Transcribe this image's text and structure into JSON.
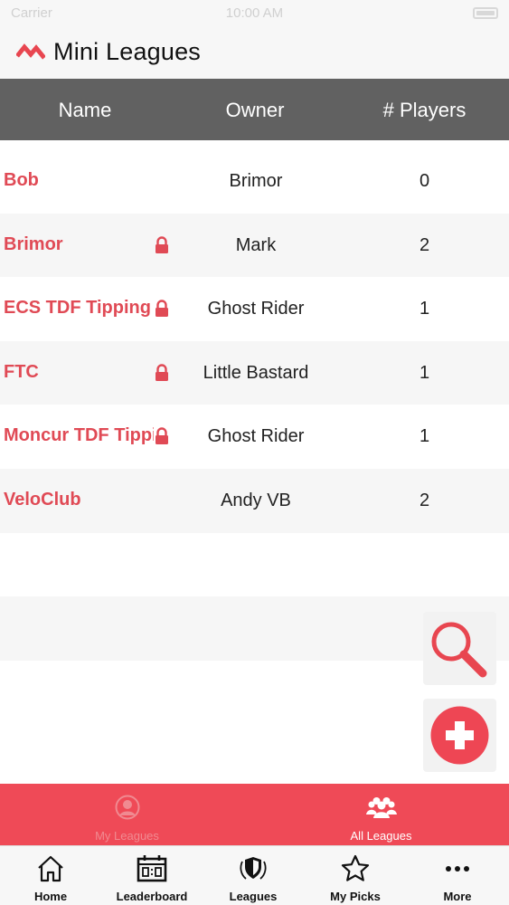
{
  "status_bar": {
    "carrier": "Carrier",
    "time": "10:00 AM"
  },
  "header": {
    "title": "Mini Leagues"
  },
  "table": {
    "columns": [
      "Name",
      "Owner",
      "# Players"
    ],
    "rows": [
      {
        "name": "Bob",
        "owner": "Brimor",
        "players": "0",
        "locked": false
      },
      {
        "name": "Brimor",
        "owner": "Mark",
        "players": "2",
        "locked": true
      },
      {
        "name": "ECS TDF Tipping",
        "owner": "Ghost Rider",
        "players": "1",
        "locked": true
      },
      {
        "name": "FTC",
        "owner": "Little Bastard",
        "players": "1",
        "locked": true
      },
      {
        "name": "Moncur TDF Tipping",
        "owner": "Ghost Rider",
        "players": "1",
        "locked": true
      },
      {
        "name": "VeloClub",
        "owner": "Andy VB",
        "players": "2",
        "locked": false
      }
    ]
  },
  "sub_tabs": {
    "my_leagues": "My Leagues",
    "all_leagues": "All Leagues"
  },
  "bottom_nav": {
    "home": "Home",
    "leaderboard": "Leaderboard",
    "leagues": "Leagues",
    "my_picks": "My Picks",
    "more": "More"
  },
  "colors": {
    "accent": "#ef4a57",
    "header_bg": "#616161",
    "league_name": "#e04a55"
  },
  "icons": [
    "lock-icon",
    "search-icon",
    "add-icon",
    "person-icon",
    "group-icon",
    "home-icon",
    "scoreboard-icon",
    "shield-icon",
    "star-icon",
    "ellipsis-icon"
  ]
}
